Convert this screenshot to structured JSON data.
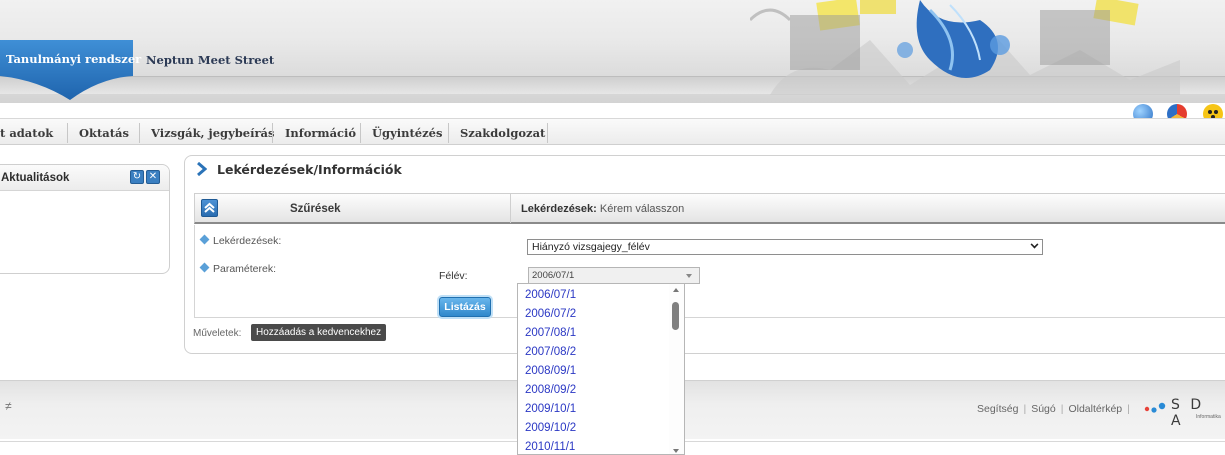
{
  "header": {
    "active_tab": "Tanulmányi rendszer",
    "other_tab": "Neptun Meet Street"
  },
  "menu": [
    "t adatok",
    "Oktatás",
    "Vizsgák, jegybeírás",
    "Információ",
    "Ügyintézés",
    "Szakdolgozat"
  ],
  "left_panel": {
    "title": "Aktualitások"
  },
  "main": {
    "title": "Lekérdezések/Információk",
    "filter_title": "Szűrések",
    "filter_info_label": "Lekérdezések:",
    "filter_info_value": "Kérem válasszon",
    "queries_label": "Lekérdezések:",
    "query_selected": "Hiányzó vizsgajegy_félév",
    "params_label": "Paraméterek:",
    "semester_label": "Félév:",
    "semester_value": "2006/07/1",
    "list_button": "Listázás",
    "ops_label": "Műveletek:",
    "fav_button": "Hozzáadás a kedvencekhez"
  },
  "semester_options": [
    "2006/07/1",
    "2006/07/2",
    "2007/08/1",
    "2007/08/2",
    "2008/09/1",
    "2008/09/2",
    "2009/10/1",
    "2009/10/2",
    "2010/11/1"
  ],
  "footer": {
    "mark": "≠",
    "links": [
      "Segítség",
      "Súgó",
      "Oldaltérkép"
    ],
    "logo_text": "S D A",
    "logo_sub": "Informatika"
  },
  "colors": {
    "brand_blue": "#2b73b8",
    "link_blue": "#2b38c4",
    "button_blue": "#2f88cc"
  }
}
